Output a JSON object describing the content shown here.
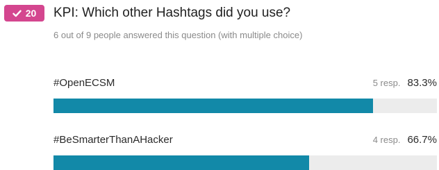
{
  "question": {
    "number": "20",
    "badge_icon": "check-icon",
    "badge_color": "#d4468f",
    "title": "KPI: Which other Hashtags did you use?",
    "subtitle": "6 out of 9 people answered this question (with multiple choice)"
  },
  "bar_color": "#1289a8",
  "options": [
    {
      "label": "#OpenECSM",
      "responses": "5 resp.",
      "percent": "83.3%",
      "fraction": 0.833
    },
    {
      "label": "#BeSmarterThanAHacker",
      "responses": "4 resp.",
      "percent": "66.7%",
      "fraction": 0.667
    }
  ]
}
